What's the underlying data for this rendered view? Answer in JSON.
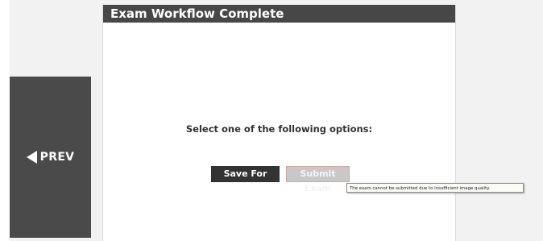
{
  "window": {
    "title": "Exam Workflow Complete"
  },
  "nav": {
    "prev_label": "PREV"
  },
  "main": {
    "prompt": "Select one of the following options:",
    "buttons": {
      "save_label": "Save For Later",
      "submit_label": "Submit Exam"
    },
    "tooltip": "The exam cannot be submitted due to insufficient image quality."
  },
  "colors": {
    "title_bar": "#474747",
    "prev_panel": "#4a4a4a",
    "save_button": "#333333",
    "submit_button_disabled": "#c8c8c8"
  },
  "icons": {
    "prev": "left-triangle-arrow-icon"
  }
}
